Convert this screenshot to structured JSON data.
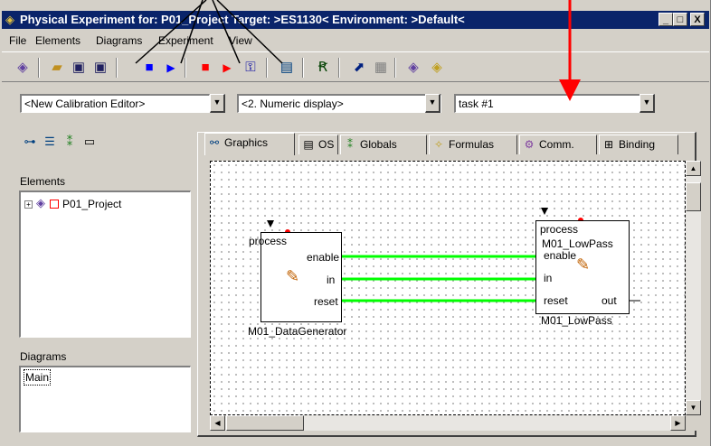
{
  "window": {
    "title": "Physical Experiment for: P01_Project  Target: >ES1130<  Environment: >Default<",
    "minimize": "_",
    "maximize": "□",
    "close": "X"
  },
  "menu": [
    "File",
    "Elements",
    "Diagrams",
    "Experiment",
    "View"
  ],
  "combos": {
    "editor": "<New Calibration Editor>",
    "display": "<2. Numeric display>",
    "task": "task  #1"
  },
  "left_panel": {
    "elements_label": "Elements",
    "tree_expander": "+",
    "tree_item": "P01_Project",
    "diagrams_label": "Diagrams",
    "diagram_item": "Main"
  },
  "tabs": [
    "Graphics",
    "OS",
    "Globals",
    "Formulas",
    "Comm.",
    "Binding"
  ],
  "diagram": {
    "block1": {
      "process": "process",
      "ports": [
        "enable",
        "in",
        "reset"
      ],
      "name": "M01_DataGenerator"
    },
    "block2": {
      "process": "process",
      "title": "M01_LowPass",
      "ports": [
        "enable",
        "in",
        "reset"
      ],
      "out": "out",
      "name": "M01_LowPass"
    }
  },
  "colors": {
    "title_bar": "#0a246a",
    "wire": "#00ff00",
    "annotation_arrow": "#ff0000"
  },
  "icons": {
    "stop": "■",
    "play": "▶",
    "dropdown": "▼"
  }
}
